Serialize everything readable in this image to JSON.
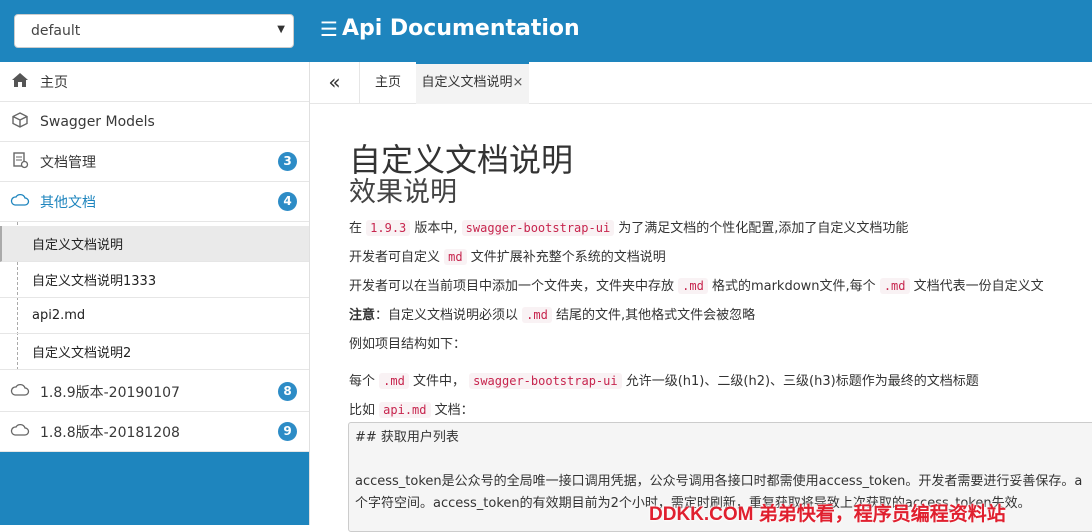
{
  "header": {
    "group_select_value": "default",
    "app_title": "Api Documentation"
  },
  "sidebar": {
    "items": [
      {
        "label": "主页",
        "icon": "home-icon"
      },
      {
        "label": "Swagger Models",
        "icon": "cube-icon"
      },
      {
        "label": "文档管理",
        "icon": "settings-doc-icon",
        "badge": "3"
      },
      {
        "label": "其他文档",
        "icon": "cloud-icon",
        "badge": "4"
      },
      {
        "label": "1.8.9版本-20190107",
        "icon": "cloud-icon",
        "badge": "8"
      },
      {
        "label": "1.8.8版本-20181208",
        "icon": "cloud-icon",
        "badge": "9"
      }
    ],
    "subitems": [
      "自定义文档说明",
      "自定义文档说明1333",
      "api2.md",
      "自定义文档说明2"
    ]
  },
  "tabs": {
    "nav": "«",
    "home": "主页",
    "current": "自定义文档说明",
    "close": "×"
  },
  "doc": {
    "h1": "自定义文档说明",
    "h2": "效果说明",
    "p1_a": "在 ",
    "p1_code1": "1.9.3",
    "p1_b": " 版本中, ",
    "p1_code2": "swagger-bootstrap-ui",
    "p1_c": " 为了满足文档的个性化配置,添加了自定义文档功能",
    "p2_a": "开发者可自定义 ",
    "p2_code": "md",
    "p2_b": " 文件扩展补充整个系统的文档说明",
    "p3_a": "开发者可以在当前项目中添加一个文件夹，文件夹中存放 ",
    "p3_code1": ".md",
    "p3_b": " 格式的markdown文件,每个 ",
    "p3_code2": ".md",
    "p3_c": " 文档代表一份自定义文",
    "p4_bold": "注意",
    "p4_a": "：自定义文档说明必须以 ",
    "p4_code": ".md",
    "p4_b": " 结尾的文件,其他格式文件会被忽略",
    "p5": "例如项目结构如下：",
    "p6_a": "每个 ",
    "p6_code1": ".md",
    "p6_b": " 文件中， ",
    "p6_code2": "swagger-bootstrap-ui",
    "p6_c": " 允许一级(h1)、二级(h2)、三级(h3)标题作为最终的文档标题",
    "p7_a": "比如 ",
    "p7_code": "api.md",
    "p7_b": " 文档：",
    "pre_line1": "## 获取用户列表",
    "pre_line2": "access_token是公众号的全局唯一接口调用凭据，公众号调用各接口时都需使用access_token。开发者需要进行妥善保存。a",
    "pre_line3": "个字符空间。access_token的有效期目前为2个小时，需定时刷新，重复获取将导致上次获取的access_token失效。"
  },
  "watermark": "DDKK.COM 弟弟快看，程序员编程资料站"
}
